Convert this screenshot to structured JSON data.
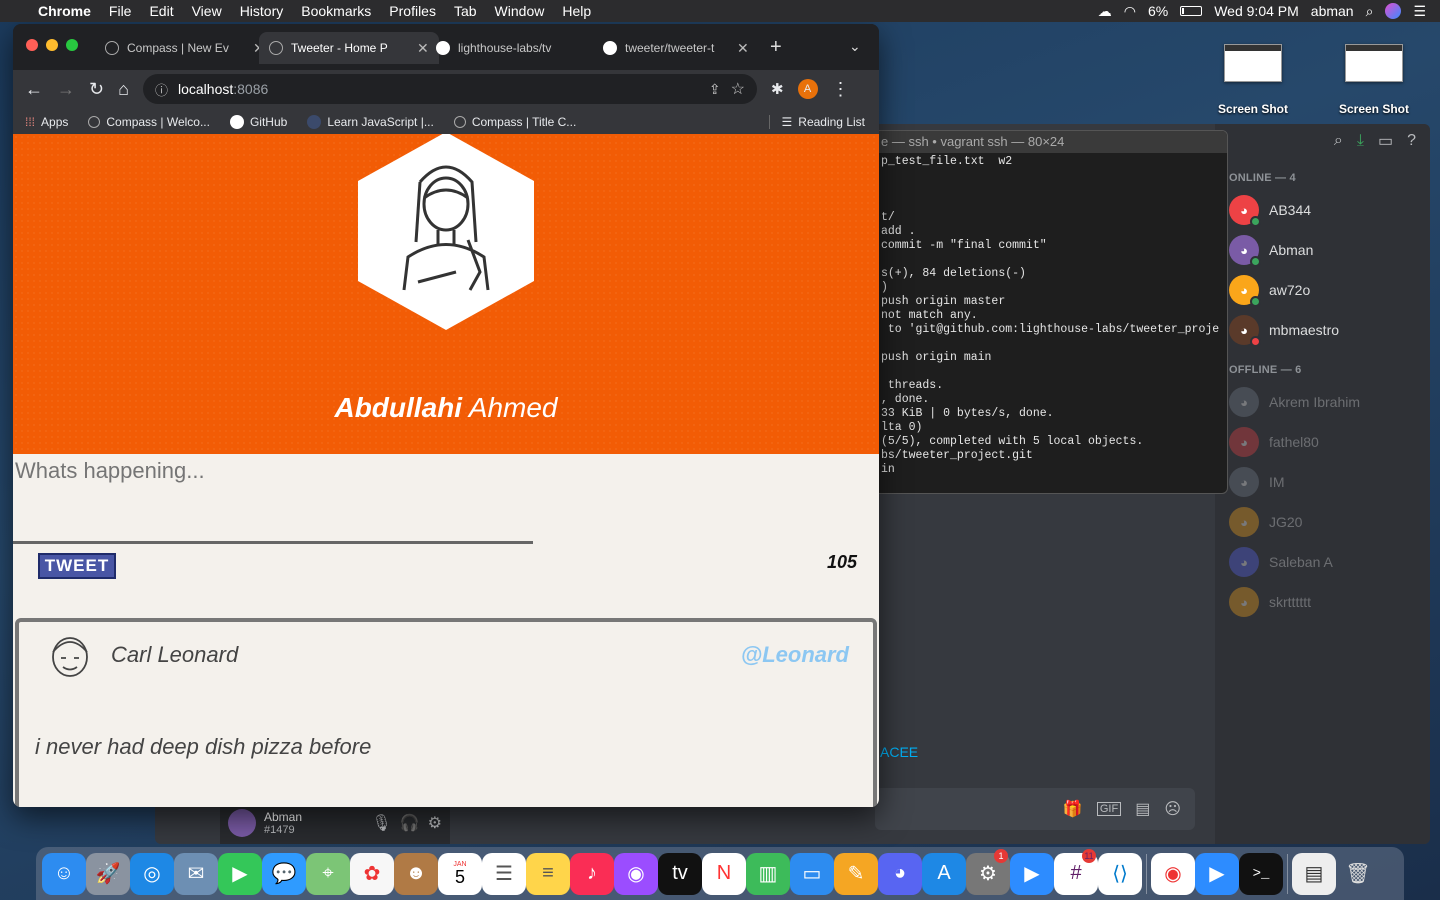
{
  "menubar": {
    "apple": "",
    "app": "Chrome",
    "menus": [
      "File",
      "Edit",
      "View",
      "History",
      "Bookmarks",
      "Profiles",
      "Tab",
      "Window",
      "Help"
    ],
    "battery": "6%",
    "clock": "Wed 9:04 PM",
    "user": "abman"
  },
  "desktop": {
    "icons": [
      {
        "label": "Screen Shot"
      },
      {
        "label": "Screen Shot"
      }
    ]
  },
  "chrome": {
    "tabs": [
      {
        "title": "Compass | New Ev",
        "active": false
      },
      {
        "title": "Tweeter - Home P",
        "active": true
      },
      {
        "title": "lighthouse-labs/tv",
        "active": false
      },
      {
        "title": "tweeter/tweeter-t",
        "active": false
      }
    ],
    "url_host": "localhost",
    "url_port": ":8086",
    "profile_initial": "A",
    "bookmarks": [
      "Apps",
      "Compass | Welco...",
      "GitHub",
      "Learn JavaScript |...",
      "Compass | Title C..."
    ],
    "reading_list": "Reading List"
  },
  "tweeter": {
    "first_name": "Abdullahi",
    "last_name": " Ahmed",
    "compose_placeholder": "Whats happening...",
    "tweet_button": "TWEET",
    "counter": "105",
    "tweets": [
      {
        "author": "Carl Leonard",
        "handle": "@Leonard",
        "content": "i never had deep dish pizza before"
      }
    ]
  },
  "terminal": {
    "title": "e — ssh • vagrant ssh — 80×24",
    "lines": [
      "p_test_file.txt  w2",
      "",
      "",
      "",
      "t/",
      "add .",
      "commit -m \"final commit\"",
      "",
      "s(+), 84 deletions(-)",
      ")",
      "push origin master",
      "not match any.",
      " to 'git@github.com:lighthouse-labs/tweeter_proje",
      "",
      "push origin main",
      "",
      " threads.",
      ", done.",
      "33 KiB | 0 bytes/s, done.",
      "lta 0)",
      "(5/5), completed with 5 local objects.",
      "bs/tweeter_project.git",
      "in"
    ]
  },
  "discord": {
    "online_header": "ONLINE — 4",
    "offline_header": "OFFLINE — 6",
    "online": [
      {
        "name": "AB344",
        "color": "#ed4245",
        "status": "#3ba55d"
      },
      {
        "name": "Abman",
        "color": "#7a5ba6",
        "status": "#3ba55d"
      },
      {
        "name": "aw72o",
        "color": "#faa61a",
        "status": "#3ba55d"
      },
      {
        "name": "mbmaestro",
        "color": "#5a3a2a",
        "status": "#ed4245"
      }
    ],
    "offline": [
      {
        "name": "Akrem Ibrahim",
        "color": "#747f8d"
      },
      {
        "name": "fathel80",
        "color": "#ed4245"
      },
      {
        "name": "IM",
        "color": "#747f8d"
      },
      {
        "name": "JG20",
        "color": "#faa61a"
      },
      {
        "name": "Saleban A",
        "color": "#5865f2"
      },
      {
        "name": "skrtttttt",
        "color": "#faa61a"
      }
    ],
    "user_name": "Abman",
    "user_tag": "#1479",
    "link_fragment": "ACEE"
  },
  "dock": {
    "calendar_month": "JAN",
    "calendar_day": "5",
    "system_prefs_badge": "1",
    "slack_badge": "11"
  }
}
